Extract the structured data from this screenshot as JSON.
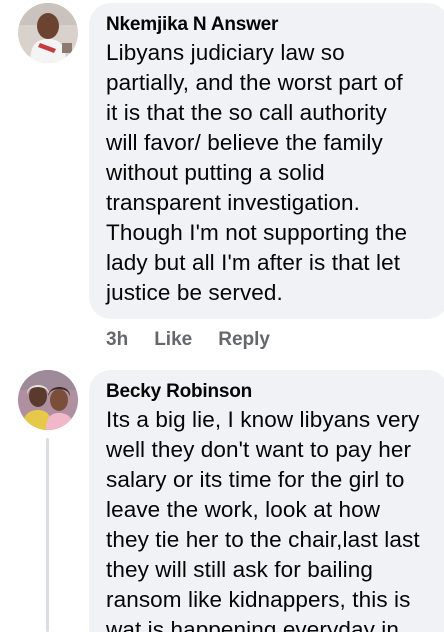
{
  "comments": [
    {
      "author": "Nkemjika N Answer",
      "avatar_icon": "profile-photo-man-icon",
      "text": "Libyans judiciary law so\npartially,  and the worst part of\nit is that the so call authority\nwill favor/ believe the family\nwithout putting a solid\ntransparent investigation.\nThough I'm not supporting the\nlady but all I'm after is that let\njustice be served.",
      "time": "3h",
      "like_label": "Like",
      "reply_label": "Reply"
    },
    {
      "author": "Becky Robinson",
      "avatar_icon": "profile-photo-couple-icon",
      "text": "Its a big lie, I know libyans very\nwell they don't want to pay her\nsalary or its time for the girl to\nleave the work, look at how\nthey tie her to the chair,last last\nthey will still ask for bailing\nransom like kidnappers, this is\nwat is happening everyday in"
    }
  ],
  "colors": {
    "bubble_bg": "#f0f2f5",
    "text": "#050505",
    "secondary_text": "#65676b"
  }
}
